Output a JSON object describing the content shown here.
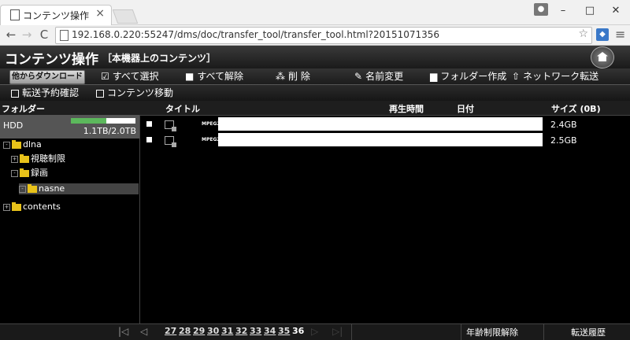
{
  "browser": {
    "tab_title": "コンテンツ操作",
    "url": "192.168.0.220:55247/dms/doc/transfer_tool/transfer_tool.html?20151071356"
  },
  "app": {
    "title": "コンテンツ操作",
    "subtitle": "［本機器上のコンテンツ］"
  },
  "actions": {
    "download": "他からダウンロード",
    "select_all": "すべて選択",
    "deselect_all": "すべて解除",
    "delete": "削 除",
    "rename": "名前変更",
    "new_folder": "フォルダー作成",
    "network_transfer": "ネットワーク転送",
    "reservation_check": "転送予約確認",
    "move": "コンテンツ移動"
  },
  "list_header": {
    "folder": "フォルダー",
    "title": "タイトル",
    "duration": "再生時間",
    "date": "日付",
    "size": "サイズ (0B)"
  },
  "hdd": {
    "label": "HDD",
    "usage": "1.1TB/2.0TB",
    "usage_fraction": 0.55
  },
  "tree": [
    "dlna",
    "視聴制限",
    "録画",
    "nasne",
    "contents"
  ],
  "rows": [
    {
      "format": "MPEG2",
      "size": "2.4GB"
    },
    {
      "format": "MPEG2",
      "size": "2.5GB"
    }
  ],
  "pager": {
    "pages": [
      "27",
      "28",
      "29",
      "30",
      "31",
      "32",
      "33",
      "34",
      "35"
    ],
    "current": "36",
    "age_limit": "年齢制限解除",
    "history": "転送履歴"
  }
}
